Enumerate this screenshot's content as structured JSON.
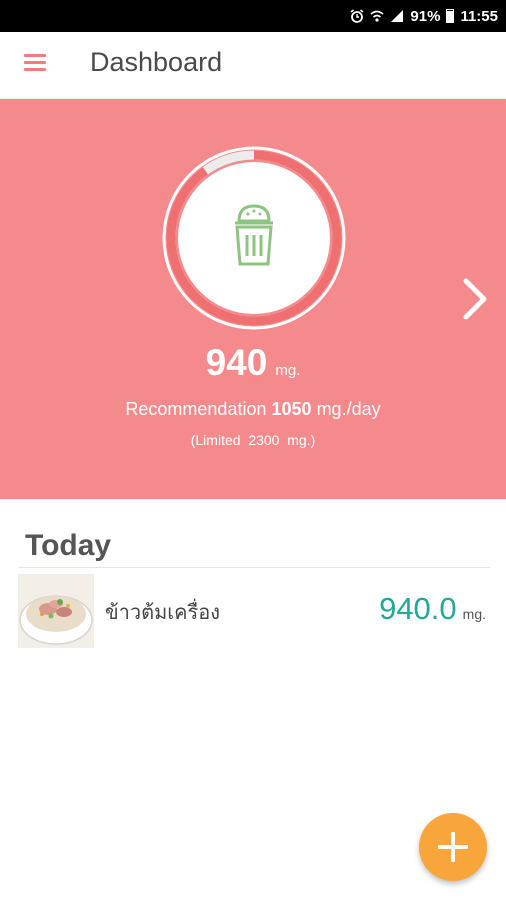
{
  "status_bar": {
    "battery": "91%",
    "time": "11:55",
    "battery_level": 0.91,
    "icons": [
      "alarm-icon",
      "wifi-icon",
      "signal-icon",
      "battery-icon"
    ]
  },
  "app_bar": {
    "title": "Dashboard",
    "menu_icon": "menu-icon"
  },
  "hero": {
    "background_color": "#f48a8c",
    "icon": "salt-shaker-icon",
    "value": "940",
    "value_unit": "mg.",
    "recommendation_label": "Recommendation",
    "recommendation_value": "1050",
    "recommendation_unit": "mg./day",
    "limited_label": "(Limited",
    "limited_value": "2300",
    "limited_unit": "mg.)",
    "progress_fraction": 0.9,
    "next_icon": "chevron-right-icon"
  },
  "today": {
    "title": "Today",
    "items": [
      {
        "name": "ข้าวต้มเครื่อง",
        "amount": "940.0",
        "unit": "mg.",
        "amount_color": "#22a996"
      }
    ]
  },
  "fab": {
    "icon": "plus-icon",
    "color": "#f8a53c"
  }
}
